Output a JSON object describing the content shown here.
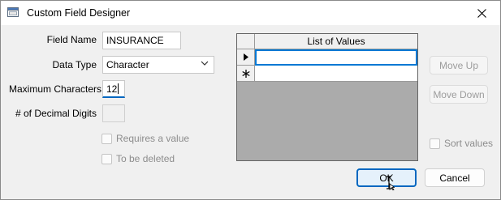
{
  "window": {
    "title": "Custom Field Designer",
    "icon": "window-app-icon",
    "close_icon": "close-icon"
  },
  "form": {
    "field_name": {
      "label": "Field Name",
      "value": "INSURANCE"
    },
    "data_type": {
      "label": "Data Type",
      "value": "Character"
    },
    "max_chars": {
      "label": "Maximum Characters",
      "value": "12"
    },
    "decimal_digits": {
      "label": "# of Decimal Digits",
      "value": ""
    },
    "requires_value": {
      "label": "Requires a value",
      "checked": false,
      "enabled": false
    },
    "to_be_deleted": {
      "label": "To be deleted",
      "checked": false,
      "enabled": false
    }
  },
  "values_grid": {
    "column_header": "List of Values",
    "rows": [
      {
        "indicator": "current-row-arrow-icon",
        "value": ""
      },
      {
        "indicator": "new-row-asterisk-icon",
        "value": ""
      }
    ]
  },
  "buttons": {
    "move_up": "Move Up",
    "move_down": "Move Down",
    "sort_values": "Sort values",
    "ok": "OK",
    "cancel": "Cancel"
  },
  "colors": {
    "accent": "#0067c0",
    "grid_background": "#ababab",
    "disabled_text": "#8d8d8d"
  }
}
